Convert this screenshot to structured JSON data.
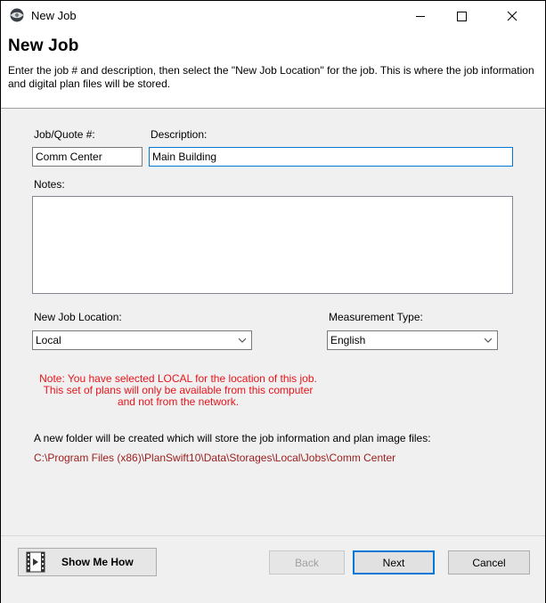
{
  "window": {
    "title": "New Job",
    "minimize_glyph": "—",
    "maximize_glyph": "☐",
    "close_glyph": "✕"
  },
  "header": {
    "title": "New Job",
    "description": "Enter the job # and description, then select the \"New Job Location\" for the job. This is where the job information and digital plan files will be stored."
  },
  "form": {
    "job_label": "Job/Quote #:",
    "job_value": "Comm Center",
    "description_label": "Description:",
    "description_value": "Main Building",
    "notes_label": "Notes:",
    "notes_value": "",
    "location_label": "New Job Location:",
    "location_value": "Local",
    "measurement_label": "Measurement Type:",
    "measurement_value": "English"
  },
  "note": {
    "line1": "Note: You have selected LOCAL for the location of this job.",
    "line2": "This set of plans will only be available from this computer",
    "line3": "and not from the network."
  },
  "folder": {
    "info": "A new folder will be created which will store the job information and plan image files:",
    "path": "C:\\Program Files (x86)\\PlanSwift10\\Data\\Storages\\Local\\Jobs\\Comm Center"
  },
  "buttons": {
    "show_me_how": "Show Me How",
    "back": "Back",
    "next": "Next",
    "cancel": "Cancel"
  },
  "icons": {
    "app": "planswift-app-icon",
    "film": "film-play-icon",
    "chevron": "chevron-down-icon"
  },
  "colors": {
    "note_red": "#e8141b",
    "path_red": "#9b1c1c",
    "focus_blue": "#0078d7"
  }
}
